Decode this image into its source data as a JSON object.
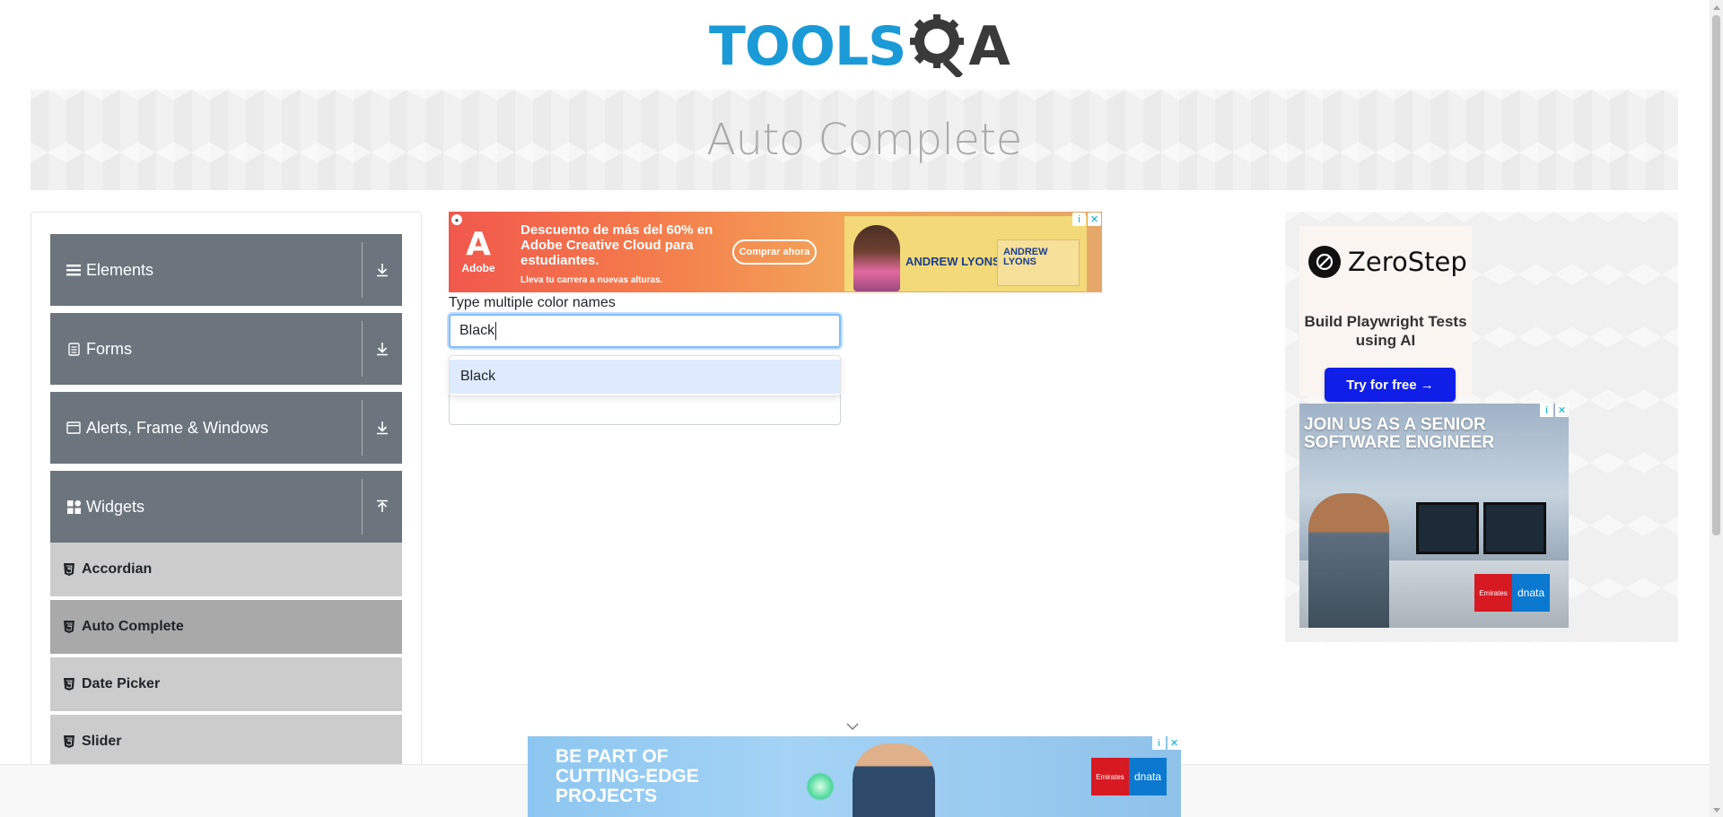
{
  "header": {
    "logo_main": "TOOLS",
    "logo_end": "A"
  },
  "banner": {
    "title": "Auto Complete"
  },
  "sidebar": {
    "groups": [
      {
        "label": "Elements",
        "icon": "hamburger-icon",
        "state": "collapsed"
      },
      {
        "label": "Forms",
        "icon": "form-icon",
        "state": "collapsed"
      },
      {
        "label": "Alerts, Frame & Windows",
        "icon": "window-icon",
        "state": "collapsed"
      },
      {
        "label": "Widgets",
        "icon": "widgets-icon",
        "state": "expanded"
      }
    ],
    "items": [
      {
        "label": "Accordian",
        "active": false
      },
      {
        "label": "Auto Complete",
        "active": true
      },
      {
        "label": "Date Picker",
        "active": false
      },
      {
        "label": "Slider",
        "active": false
      }
    ]
  },
  "ad_top": {
    "brand": "Adobe",
    "headline": "Descuento de más del 60% en Adobe Creative Cloud para estudiantes.",
    "subline": "Lleva tu carrera a nuevas alturas.",
    "cta": "Comprar ahora",
    "name_large": "ANDREW LYONS",
    "name_small": "ANDREW LYONS"
  },
  "form": {
    "multi_label": "Type multiple color names",
    "multi_value": "Black",
    "suggestions": [
      "Black"
    ]
  },
  "ad_right": {
    "brand": "ZeroStep",
    "tagline": "Build Playwright Tests using AI",
    "cta": "Try for free →"
  },
  "ad_emirates": {
    "headline": "JOIN US AS A SENIOR SOFTWARE ENGINEER",
    "logo_left": "Emirates",
    "logo_right": "dnata"
  },
  "ad_bottom": {
    "headline": "BE PART OF CUTTING-EDGE PROJECTS",
    "logo_left": "Emirates",
    "logo_right": "dnata"
  },
  "colors": {
    "sidebar_group": "#6c757d",
    "sidebar_item": "#cccccc",
    "sidebar_active": "#a9a9a9",
    "logo_blue": "#1a9ad6",
    "focus_border": "#80bdff",
    "option_highlight": "#deebff"
  }
}
